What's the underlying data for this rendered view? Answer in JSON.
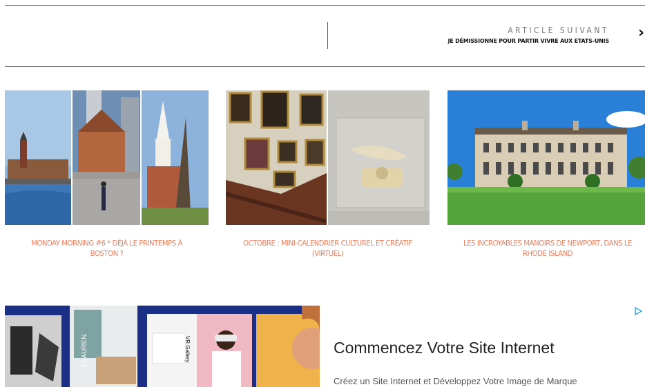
{
  "next_article": {
    "heading": "ARTICLE SUIVANT",
    "title": "JE DÉMISSIONNE POUR PARTIR VIVRE AUX ETATS-UNIS",
    "arrow_icon": "chevron-right-icon"
  },
  "related": [
    {
      "caption": "MONDAY MORNING #6 * DÉJÀ LE PRINTEMPS À BOSTON ?"
    },
    {
      "caption": "OCTOBRE : MINI-CALENDRIER CULTUREL ET CRÉATIF (VIRTUEL)"
    },
    {
      "caption": "LES INCROYABLES MANOIRS DE NEWPORT, DANS LE RHODE ISLAND"
    }
  ],
  "ad": {
    "headline": "Commencez Votre Site Internet",
    "body": "Créez un Site Internet et Développez Votre Image de Marque",
    "image_labels": {
      "brand": "J.LAUREN",
      "gallery": "VR Gallery"
    },
    "choice_icon": "adchoices-icon"
  },
  "colors": {
    "accent": "#f0805f",
    "ad_background": "#1c2f87"
  }
}
